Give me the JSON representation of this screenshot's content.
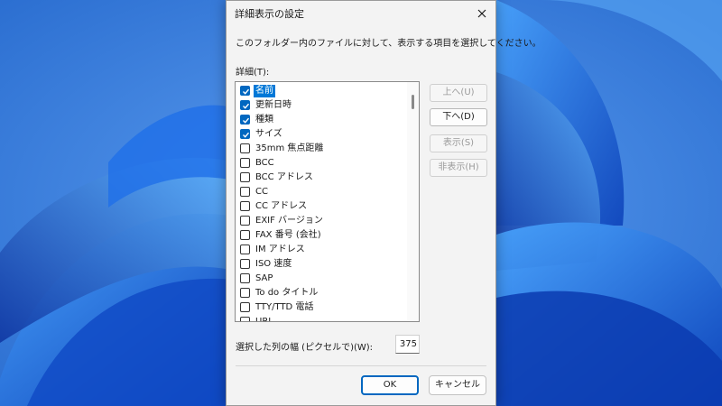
{
  "dialog": {
    "title": "詳細表示の設定",
    "description": "このフォルダー内のファイルに対して、表示する項目を選択してください。",
    "list_label": "詳細(T):",
    "items": [
      {
        "label": "名前",
        "checked": true,
        "selected": true
      },
      {
        "label": "更新日時",
        "checked": true
      },
      {
        "label": "種類",
        "checked": true
      },
      {
        "label": "サイズ",
        "checked": true
      },
      {
        "label": "35mm 焦点距離",
        "checked": false
      },
      {
        "label": "BCC",
        "checked": false
      },
      {
        "label": "BCC アドレス",
        "checked": false
      },
      {
        "label": "CC",
        "checked": false
      },
      {
        "label": "CC アドレス",
        "checked": false
      },
      {
        "label": "EXIF バージョン",
        "checked": false
      },
      {
        "label": "FAX 番号 (会社)",
        "checked": false
      },
      {
        "label": "IM アドレス",
        "checked": false
      },
      {
        "label": "ISO 速度",
        "checked": false
      },
      {
        "label": "SAP",
        "checked": false
      },
      {
        "label": "To do タイトル",
        "checked": false
      },
      {
        "label": "TTY/TTD 電話",
        "checked": false
      },
      {
        "label": "URL",
        "checked": false
      }
    ],
    "side_buttons": {
      "move_up": "上へ(U)",
      "move_down": "下へ(D)",
      "show": "表示(S)",
      "hide": "非表示(H)"
    },
    "width_label": "選択した列の幅 (ピクセルで)(W):",
    "width_value": "375",
    "ok_label": "OK",
    "cancel_label": "キャンセル"
  },
  "colors": {
    "accent": "#0067c0",
    "selection": "#0078d7",
    "wallpaper": "#3d7fd9"
  }
}
